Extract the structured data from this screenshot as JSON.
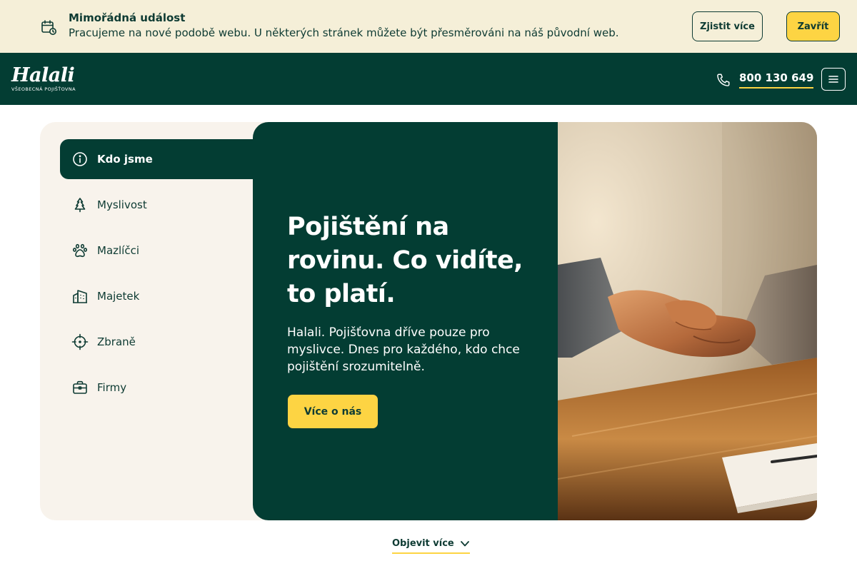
{
  "announcement": {
    "title": "Mimořádná událost",
    "message": "Pracujeme na nové podobě webu. U některých stránek můžete být přesměrováni na náš původní web.",
    "learn_more_label": "Zjistit více",
    "close_label": "Zavřít",
    "icon": "calendar-clock-icon"
  },
  "header": {
    "logo_text": "Halali",
    "logo_tagline": "VŠEOBECNÁ POJIŠŤOVNA",
    "phone": "800 130 649",
    "phone_icon": "phone-icon",
    "menu_icon": "hamburger-icon"
  },
  "sidebar": {
    "items": [
      {
        "label": "Kdo jsme",
        "icon": "info-icon",
        "active": true
      },
      {
        "label": "Myslivost",
        "icon": "tree-icon",
        "active": false
      },
      {
        "label": "Mazlíčci",
        "icon": "paw-icon",
        "active": false
      },
      {
        "label": "Majetek",
        "icon": "building-icon",
        "active": false
      },
      {
        "label": "Zbraně",
        "icon": "crosshair-icon",
        "active": false
      },
      {
        "label": "Firmy",
        "icon": "briefcase-icon",
        "active": false
      }
    ]
  },
  "hero": {
    "heading": "Pojištění na rovinu. Co vidíte, to platí.",
    "text": "Halali. Pojišťovna dříve pouze pro myslivce. Dnes pro každého, kdo chce pojištění srozumitelně.",
    "button_label": "Více o nás"
  },
  "explore": {
    "label": "Objevit více",
    "icon": "chevron-down-icon"
  },
  "colors": {
    "brand_dark": "#033d33",
    "accent_yellow": "#fdd443",
    "announce_bg": "#f5efd8",
    "card_bg": "#f8f3ec"
  }
}
